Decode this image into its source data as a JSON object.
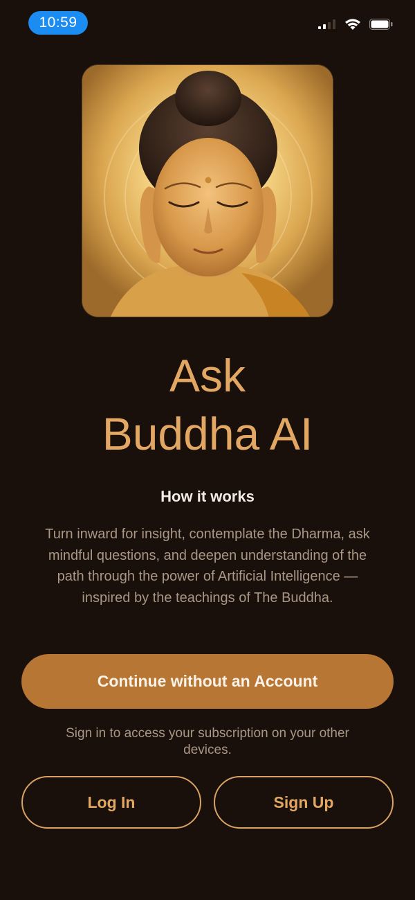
{
  "status_bar": {
    "time": "10:59",
    "icons": [
      "cellular-signal-icon",
      "wifi-icon",
      "battery-icon"
    ]
  },
  "hero": {
    "image": "buddha-portrait-image"
  },
  "title": {
    "line1": "Ask",
    "line2": "Buddha AI"
  },
  "how_it_works": {
    "heading": "How it works",
    "body": "Turn inward for insight, contemplate the Dharma, ask mindful questions, and deepen understanding of the path through the power of Artificial Intelligence — inspired by the teachings of The Buddha."
  },
  "actions": {
    "continue_label": "Continue without an Account",
    "signin_note": "Sign in to access your subscription on your other devices.",
    "login_label": "Log In",
    "signup_label": "Sign Up"
  },
  "colors": {
    "background": "#1a100b",
    "accent": "#b77634",
    "title": "#e2a763",
    "time_pill": "#1b8cf2"
  }
}
